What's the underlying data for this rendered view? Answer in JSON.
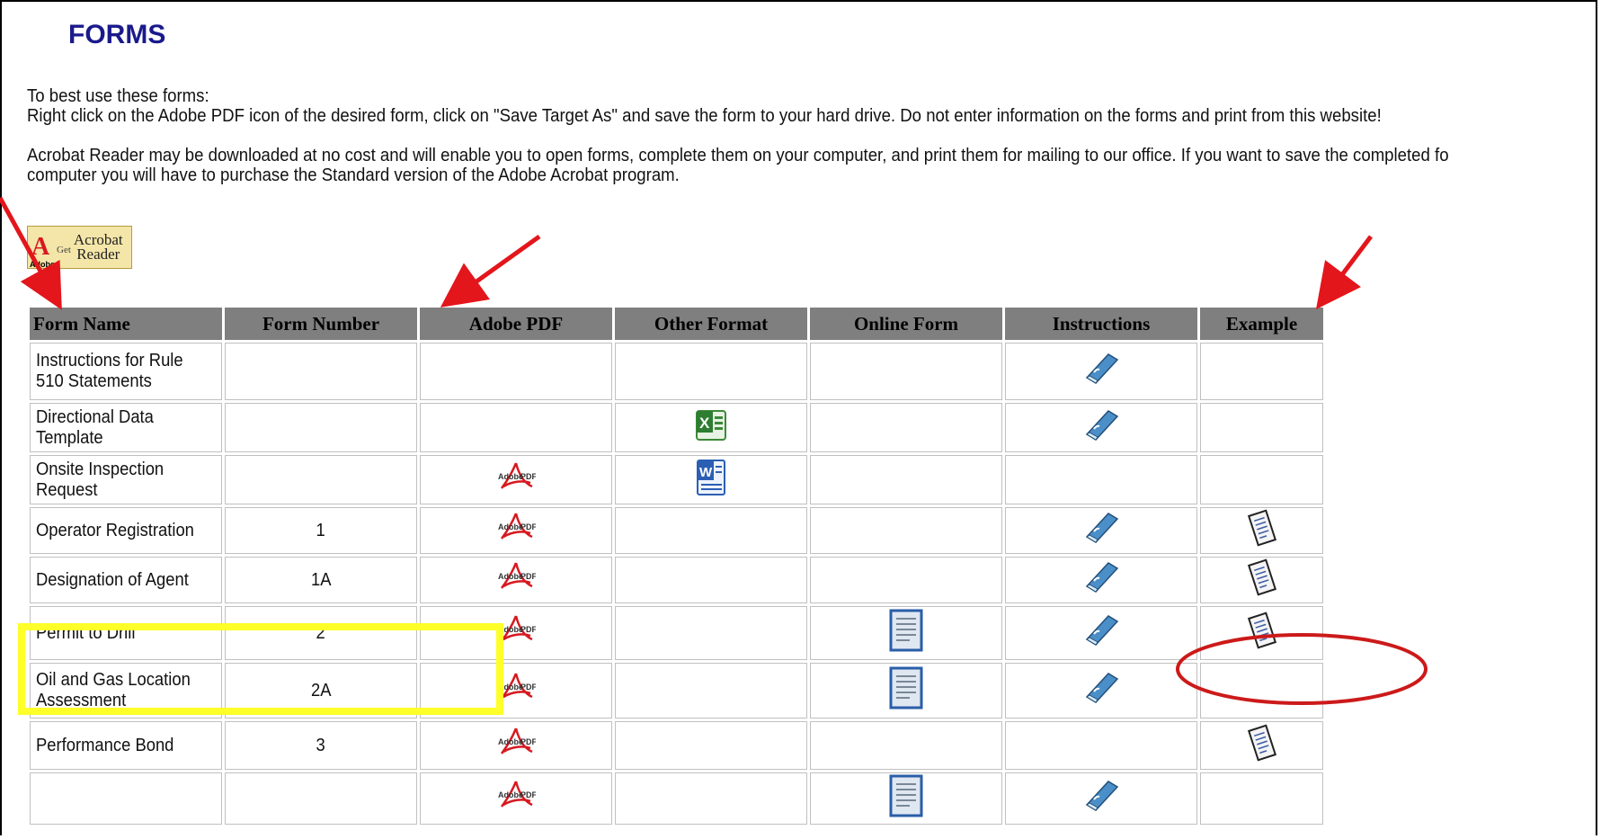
{
  "page": {
    "title": "FORMS",
    "intro_line1": "To best use these forms:",
    "intro_line2": "Right click on the Adobe PDF icon of the desired form, click on \"Save Target As\" and save the form to your hard drive.  Do not enter information on the forms and print from this website!",
    "intro_line3": "Acrobat Reader may be downloaded at no cost and will enable you to open forms, complete them on your computer, and print them for mailing to our office.  If you want to save the completed fo",
    "intro_line4": "computer you will have to purchase the Standard version of the Adobe Acrobat program."
  },
  "acrobat_badge": {
    "logo_letter": "A",
    "logo_sub": "Adobe",
    "get": "Get",
    "brand_line1": "Acrobat",
    "brand_line2": "Reader"
  },
  "table": {
    "headers": [
      "Form Name",
      "Form Number",
      "Adobe PDF",
      "Other Format",
      "Online Form",
      "Instructions",
      "Example"
    ],
    "rows": [
      {
        "name": "Instructions for Rule 510 Statements",
        "number": "",
        "pdf": false,
        "other": "",
        "online": false,
        "instructions": true,
        "example": false
      },
      {
        "name": "Directional Data Template",
        "number": "",
        "pdf": false,
        "other": "excel-icon",
        "online": false,
        "instructions": true,
        "example": false
      },
      {
        "name": "Onsite Inspection Request",
        "number": "",
        "pdf": true,
        "other": "word-icon",
        "online": false,
        "instructions": false,
        "example": false
      },
      {
        "name": "Operator Registration",
        "number": "1",
        "pdf": true,
        "other": "",
        "online": false,
        "instructions": true,
        "example": true
      },
      {
        "name": "Designation of Agent",
        "number": "1A",
        "pdf": true,
        "other": "",
        "online": false,
        "instructions": true,
        "example": true
      },
      {
        "name": "Permit to Drill",
        "number": "2",
        "pdf": true,
        "other": "",
        "online": true,
        "instructions": true,
        "example": true
      },
      {
        "name": "Oil and Gas Location Assessment",
        "number": "2A",
        "pdf": true,
        "other": "",
        "online": true,
        "instructions": true,
        "example": false
      },
      {
        "name": "Performance Bond",
        "number": "3",
        "pdf": true,
        "other": "",
        "online": false,
        "instructions": false,
        "example": true
      },
      {
        "name": "",
        "number": "",
        "pdf": true,
        "other": "",
        "online": true,
        "instructions": true,
        "example": false
      }
    ]
  },
  "pdf_icon_label": "AdobePDF",
  "annotation_colors": {
    "arrow": "#e3161b",
    "highlight": "#ffff2a",
    "ellipse": "#cc1a1a"
  }
}
